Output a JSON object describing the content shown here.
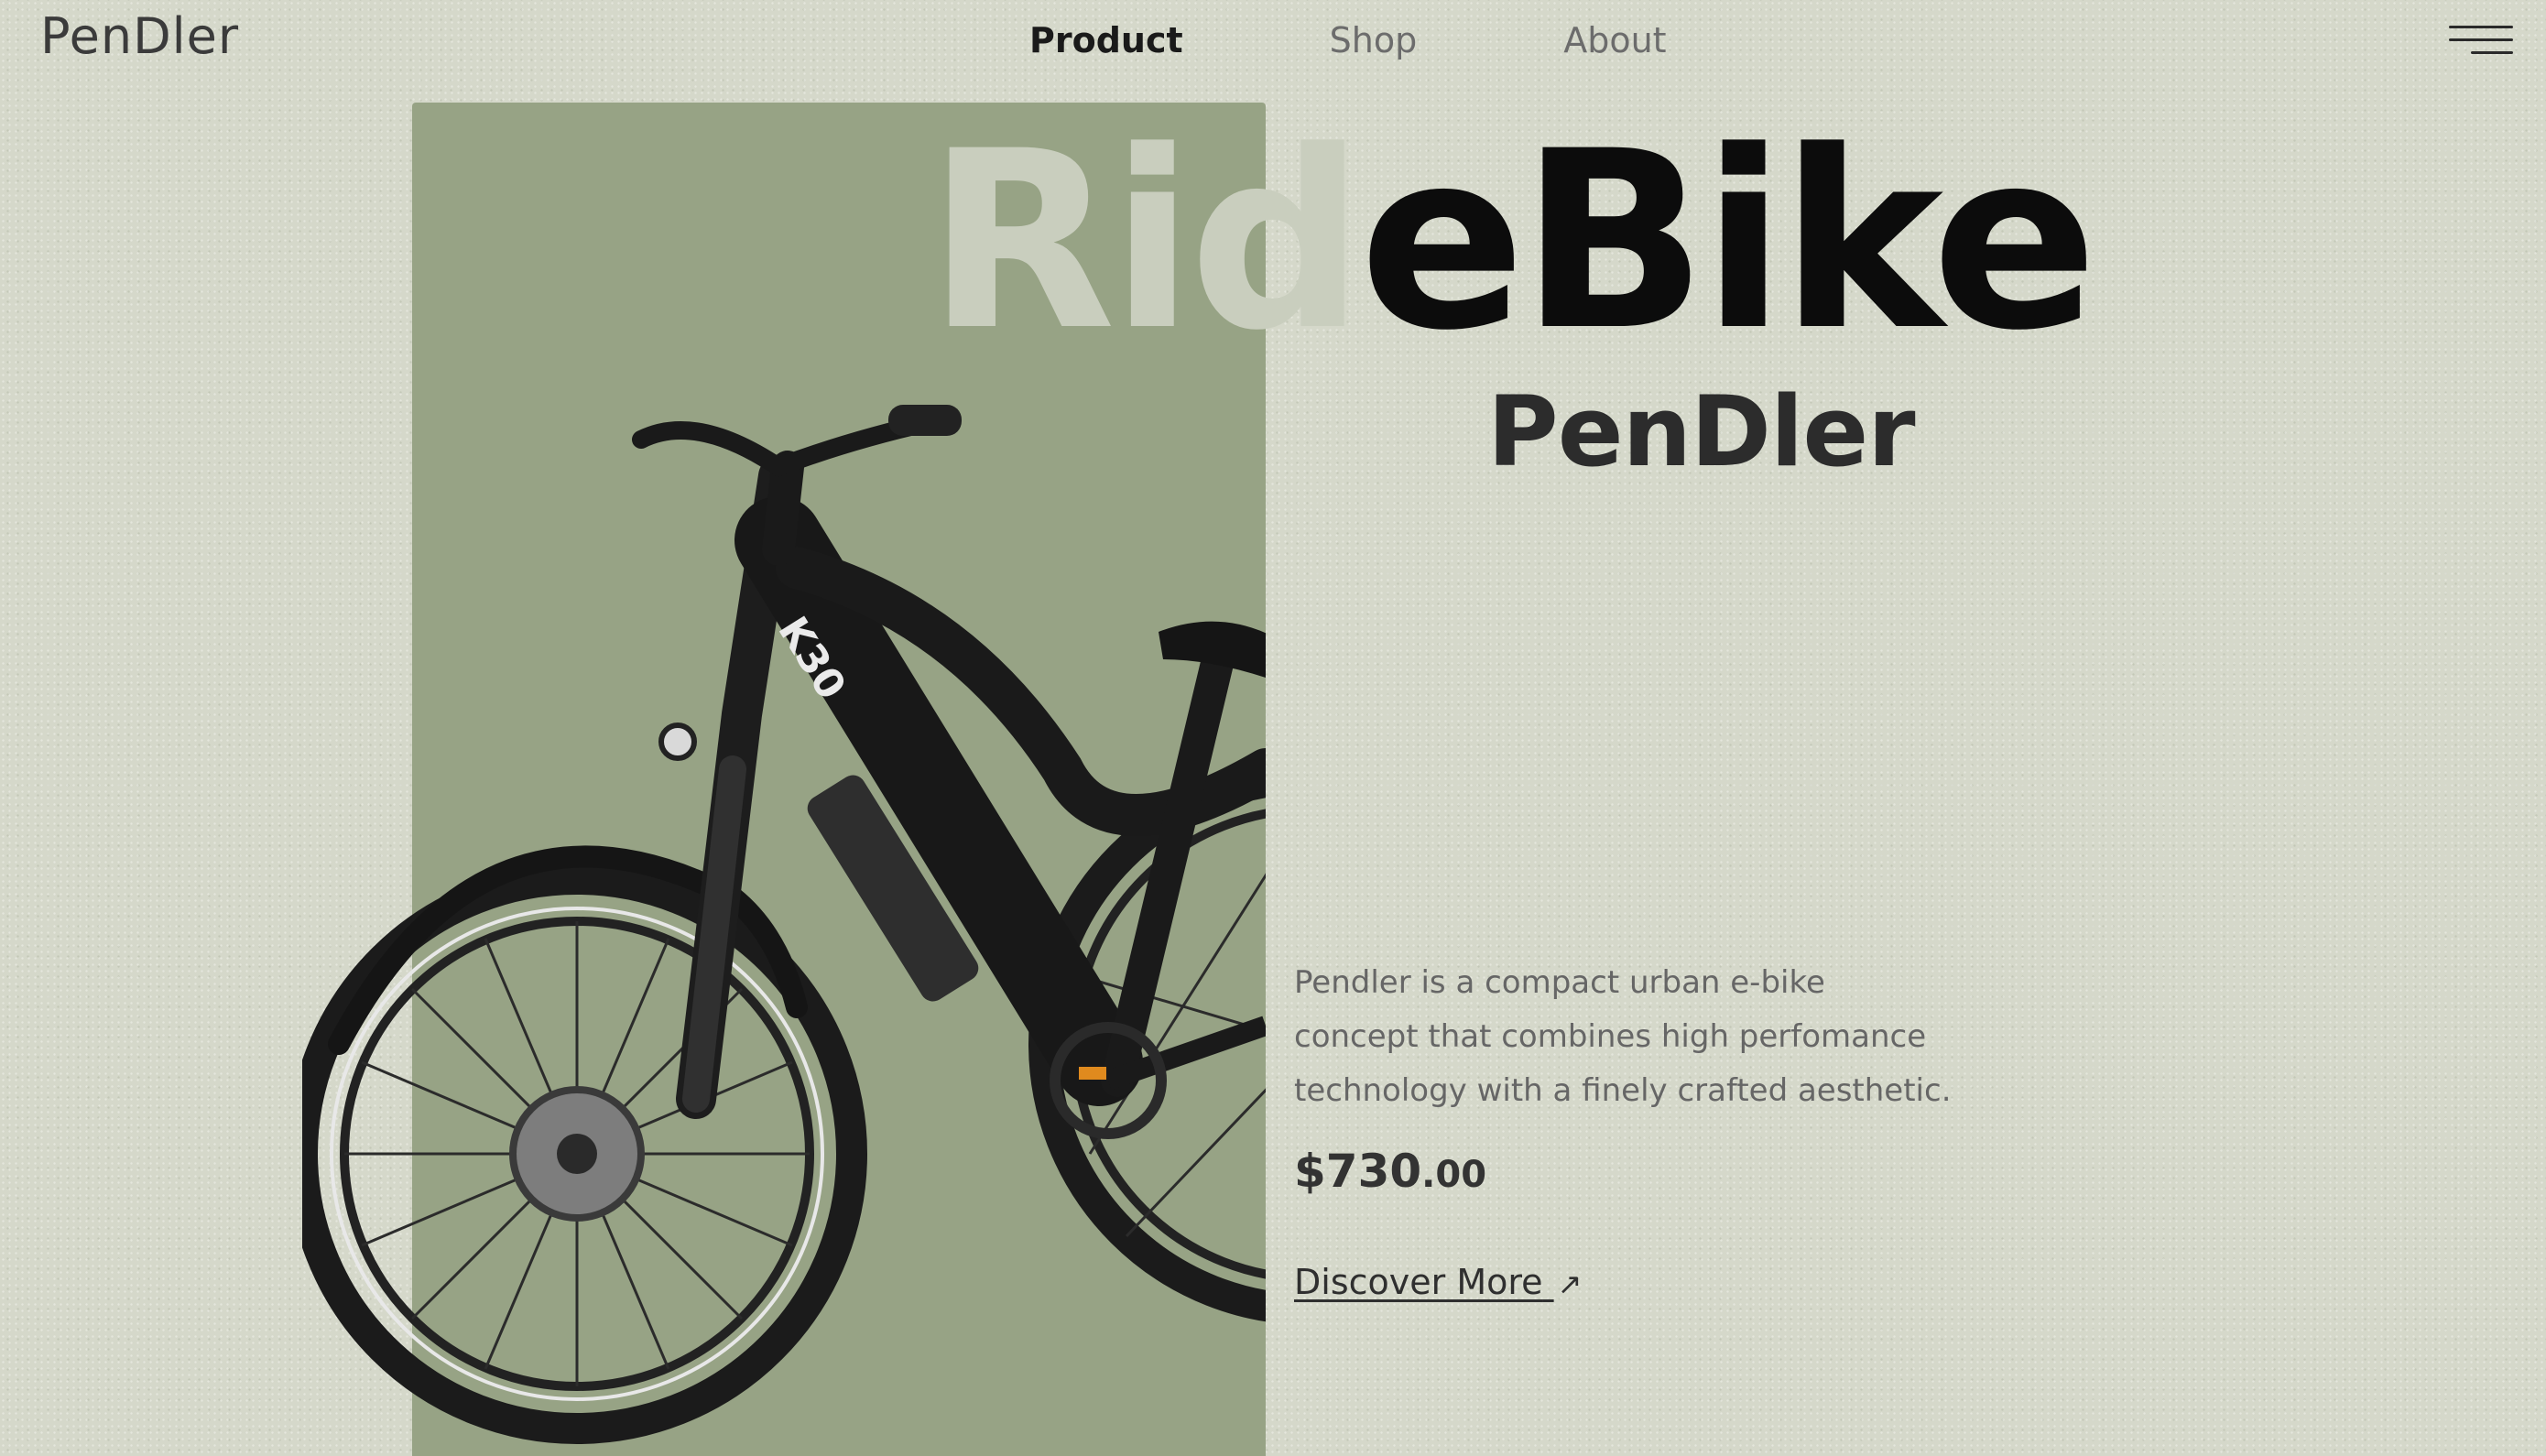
{
  "brand": {
    "logo": "PenDler"
  },
  "nav": {
    "items": [
      {
        "label": "Product",
        "active": true
      },
      {
        "label": "Shop",
        "active": false
      },
      {
        "label": "About",
        "active": false
      }
    ]
  },
  "menu": {
    "icon": "hamburger-menu-icon"
  },
  "hero": {
    "headline_faded": "Rid",
    "headline_bold": "eBike",
    "subtitle": "PenDler",
    "description": "Pendler is a compact urban e-bike concept that combines high perfomance technology with a finely crafted aesthetic.",
    "price_main": "$730",
    "price_cents": ".00",
    "cta_label": "Discover More",
    "cta_icon": "arrow-up-right-icon",
    "image_name": "ebike-image",
    "frame_label": "K30"
  },
  "colors": {
    "background": "#d5d8ca",
    "panel": "#97a385",
    "accent_dark": "#0c0c0c",
    "faded_text": "#c9cebe"
  }
}
